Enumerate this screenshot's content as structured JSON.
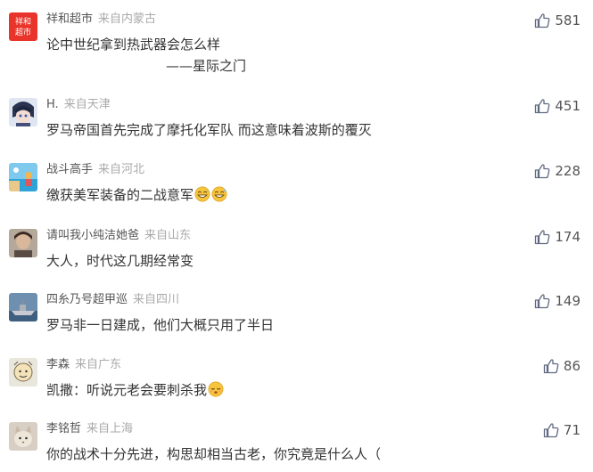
{
  "comments": [
    {
      "username": "祥和超市",
      "location": "来自内蒙古",
      "text": "论中世纪拿到热武器会怎么样",
      "text2": "——星际之门",
      "likes": "581",
      "avatar": "red-logo",
      "avatar_text": [
        "祥和",
        "超市"
      ]
    },
    {
      "username": "H.",
      "location": "来自天津",
      "text": "罗马帝国首先完成了摩托化军队 而这意味着波斯的覆灭",
      "likes": "451",
      "avatar": "anime"
    },
    {
      "username": "战斗高手",
      "location": "来自河北",
      "text": "缴获美军装备的二战意军",
      "likes": "228",
      "avatar": "beach",
      "emoji_after": [
        "grin-sweat-emoji",
        "grin-sweat-emoji"
      ]
    },
    {
      "username": "请叫我小纯洁她爸",
      "location": "来自山东",
      "text": "大人，时代这几期经常变",
      "likes": "174",
      "avatar": "photo"
    },
    {
      "username": "四糸乃号超甲巡",
      "location": "来自四川",
      "text": "罗马非一日建成，他们大概只用了半日",
      "likes": "149",
      "avatar": "ship"
    },
    {
      "username": "李森",
      "location": "来自广东",
      "text": "凯撒：听说元老会要刺杀我",
      "likes": "86",
      "avatar": "cartoon",
      "emoji_after": [
        "relieved-emoji"
      ]
    },
    {
      "username": "李铭哲",
      "location": "来自上海",
      "text": "你的战术十分先进，构思却相当古老，你究竟是什么人（",
      "likes": "71",
      "avatar": "cat"
    }
  ],
  "colors": {
    "username": "#555555",
    "location": "#aaaaaa",
    "text": "#333333",
    "like_icon": "#606a80"
  },
  "icons": {
    "like": "thumbs-up-icon"
  }
}
